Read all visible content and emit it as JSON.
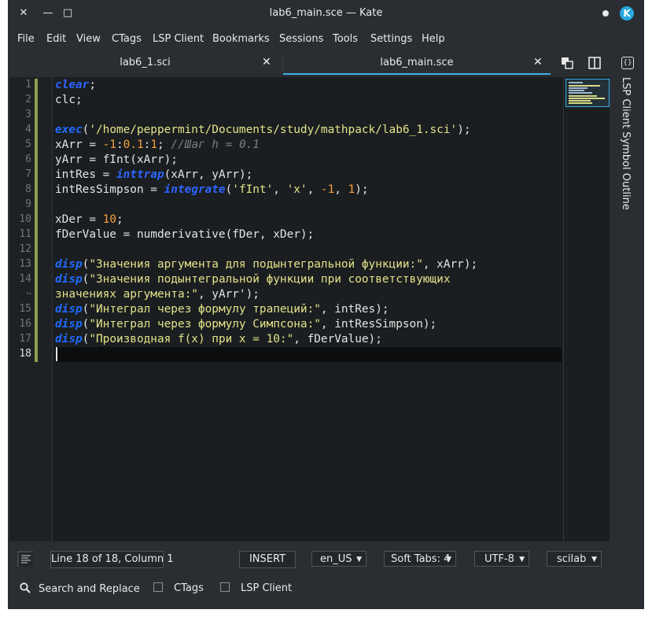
{
  "window": {
    "title": "lab6_main.sce — Kate",
    "close_glyph": "✕",
    "minimize_glyph": "—",
    "maximize_glyph": "□"
  },
  "menubar": [
    "File",
    "Edit",
    "View",
    "CTags",
    "LSP Client",
    "Bookmarks",
    "Sessions",
    "Tools",
    "Settings",
    "Help"
  ],
  "tabs": [
    {
      "label": "lab6_1.sci",
      "active": false
    },
    {
      "label": "lab6_main.sce",
      "active": true
    }
  ],
  "editor": {
    "current_line": 18,
    "lines": [
      {
        "num": "1",
        "parts": [
          {
            "t": "clear",
            "c": "kw"
          },
          {
            "t": ";",
            "c": ""
          }
        ]
      },
      {
        "num": "2",
        "parts": [
          {
            "t": "clc;",
            "c": ""
          }
        ]
      },
      {
        "num": "3",
        "parts": []
      },
      {
        "num": "4",
        "parts": [
          {
            "t": "exec",
            "c": "kw2"
          },
          {
            "t": "(",
            "c": ""
          },
          {
            "t": "'/home/peppermint/Documents/study/mathpack/lab6_1.sci'",
            "c": "str"
          },
          {
            "t": ");",
            "c": ""
          }
        ]
      },
      {
        "num": "5",
        "parts": [
          {
            "t": "xArr = ",
            "c": ""
          },
          {
            "t": "-1",
            "c": "num"
          },
          {
            "t": ":",
            "c": ""
          },
          {
            "t": "0.1",
            "c": "num"
          },
          {
            "t": ":",
            "c": ""
          },
          {
            "t": "1",
            "c": "num"
          },
          {
            "t": "; ",
            "c": ""
          },
          {
            "t": "//Шаг h = 0.1",
            "c": "cmt"
          }
        ]
      },
      {
        "num": "6",
        "parts": [
          {
            "t": "yArr = fInt(xArr);",
            "c": ""
          }
        ]
      },
      {
        "num": "7",
        "parts": [
          {
            "t": "intRes = ",
            "c": ""
          },
          {
            "t": "inttrap",
            "c": "kw"
          },
          {
            "t": "(xArr, yArr);",
            "c": ""
          }
        ]
      },
      {
        "num": "8",
        "parts": [
          {
            "t": "intResSimpson = ",
            "c": ""
          },
          {
            "t": "integrate",
            "c": "kw"
          },
          {
            "t": "(",
            "c": ""
          },
          {
            "t": "'fInt'",
            "c": "str"
          },
          {
            "t": ", ",
            "c": ""
          },
          {
            "t": "'x'",
            "c": "str"
          },
          {
            "t": ", ",
            "c": ""
          },
          {
            "t": "-1",
            "c": "num"
          },
          {
            "t": ", ",
            "c": ""
          },
          {
            "t": "1",
            "c": "num"
          },
          {
            "t": ");",
            "c": ""
          }
        ]
      },
      {
        "num": "9",
        "parts": []
      },
      {
        "num": "10",
        "parts": [
          {
            "t": "xDer = ",
            "c": ""
          },
          {
            "t": "10",
            "c": "num"
          },
          {
            "t": ";",
            "c": ""
          }
        ]
      },
      {
        "num": "11",
        "parts": [
          {
            "t": "fDerValue = numderivative(fDer, xDer);",
            "c": ""
          }
        ]
      },
      {
        "num": "12",
        "parts": []
      },
      {
        "num": "13",
        "parts": [
          {
            "t": "disp",
            "c": "disp"
          },
          {
            "t": "(",
            "c": ""
          },
          {
            "t": "\"Значения аргумента для подынтегральной функции:\"",
            "c": "str"
          },
          {
            "t": ", xArr);",
            "c": ""
          }
        ]
      },
      {
        "num": "14",
        "parts": [
          {
            "t": "disp",
            "c": "disp"
          },
          {
            "t": "(",
            "c": ""
          },
          {
            "t": "\"Значения подынтегральной функции при соответствующих",
            "c": "str"
          }
        ]
      },
      {
        "num": "↪",
        "parts": [
          {
            "t": "значениях аргумента:\"",
            "c": "str"
          },
          {
            "t": ", yArr');",
            "c": ""
          }
        ]
      },
      {
        "num": "15",
        "parts": [
          {
            "t": "disp",
            "c": "disp"
          },
          {
            "t": "(",
            "c": ""
          },
          {
            "t": "\"Интеграл через формулу трапеций:\"",
            "c": "str"
          },
          {
            "t": ", intRes);",
            "c": ""
          }
        ]
      },
      {
        "num": "16",
        "parts": [
          {
            "t": "disp",
            "c": "disp"
          },
          {
            "t": "(",
            "c": ""
          },
          {
            "t": "\"Интеграл через формулу Симпсона:\"",
            "c": "str"
          },
          {
            "t": ", intResSimpson);",
            "c": ""
          }
        ]
      },
      {
        "num": "17",
        "parts": [
          {
            "t": "disp",
            "c": "disp"
          },
          {
            "t": "(",
            "c": ""
          },
          {
            "t": "\"Производная f(x) при x = 10:\"",
            "c": "str"
          },
          {
            "t": ", fDerValue);",
            "c": ""
          }
        ]
      },
      {
        "num": "18",
        "parts": []
      }
    ]
  },
  "sidebar": {
    "label": "LSP Client Symbol Outline"
  },
  "statusbar": {
    "position": "Line 18 of 18, Column 1",
    "mode": "INSERT",
    "dictionary": "en_US",
    "indent": "Soft Tabs: 4",
    "encoding": "UTF-8",
    "syntax": "scilab"
  },
  "toolviews": [
    {
      "label": "Search and Replace",
      "icon": "search-icon"
    },
    {
      "label": "CTags",
      "icon": "ctags-icon"
    },
    {
      "label": "LSP Client",
      "icon": "lsp-icon"
    }
  ],
  "colors": {
    "accent": "#3daee9",
    "keyword": "#2c64ff",
    "string": "#e3e38a",
    "number": "#f6a23e",
    "comment": "#7a8086",
    "modified_marker": "#8ba04f"
  }
}
